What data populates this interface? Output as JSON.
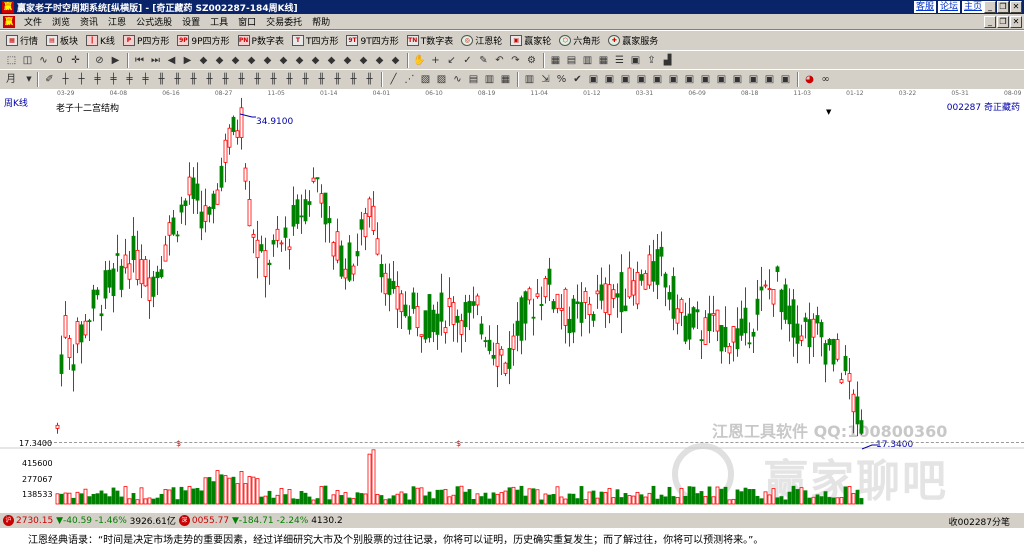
{
  "window": {
    "title": "赢家老子时空周期系统[纵横版] - [奇正藏药  SZ002287-184周K线]",
    "links": [
      "客服",
      "论坛",
      "主页"
    ]
  },
  "menu": [
    "文件",
    "浏览",
    "资讯",
    "江恩",
    "公式选股",
    "设置",
    "工具",
    "窗口",
    "交易委托",
    "帮助"
  ],
  "toolbar1": [
    {
      "label": "行情",
      "icon": "grid-icon"
    },
    {
      "label": "板块",
      "icon": "board-icon"
    },
    {
      "label": "K线",
      "icon": "kline-icon"
    },
    {
      "label": "P四方形",
      "icon": "p-square-icon"
    },
    {
      "label": "9P四方形",
      "icon": "9p-square-icon"
    },
    {
      "label": "P数字表",
      "icon": "p-table-icon"
    },
    {
      "label": "T四方形",
      "icon": "t-square-icon"
    },
    {
      "label": "9T四方形",
      "icon": "9t-square-icon"
    },
    {
      "label": "T数字表",
      "icon": "t-table-icon"
    },
    {
      "label": "江恩轮",
      "icon": "gann-wheel-icon"
    },
    {
      "label": "赢家轮",
      "icon": "winner-wheel-icon"
    },
    {
      "label": "六角形",
      "icon": "hexagon-icon"
    },
    {
      "label": "赢家服务",
      "icon": "service-icon"
    }
  ],
  "chart": {
    "period": "周K线",
    "period_select": "月",
    "indicator": "老子十二宫结构",
    "stock": "002287 奇正藏药",
    "high_label": "34.9100",
    "low_label": "17.3400",
    "low_axis_label": "17.3400",
    "watermark_text": "江恩工具软件 QQ:100800360",
    "watermark_big": "赢家聊吧",
    "dates": [
      "03-29",
      "04-08",
      "06-16",
      "08-27",
      "11-05",
      "01-14",
      "04-01",
      "06-10",
      "08-19",
      "11-04",
      "01-12",
      "03-31",
      "06-09",
      "08-18",
      "11-03",
      "01-12",
      "03-22",
      "05-31",
      "08-09"
    ],
    "vol_ticks": [
      "415600",
      "277067",
      "138533"
    ],
    "colors": {
      "up": "#ff0000",
      "down": "#008000",
      "accent": "#0000aa"
    }
  },
  "status": {
    "sh_index": "2730.15",
    "sh_change": "▼-40.59",
    "sh_pct": "-1.46%",
    "sh_amount": "3926.61亿",
    "sz_index": "0055.77",
    "sz_change": "▼-184.71",
    "sz_pct": "-2.24%",
    "sz_amount": "4130.2",
    "recv": "收002287分笔"
  },
  "quote": "江恩经典语录：“时间是决定市场走势的重要因素，经过详细研究大市及个别股票的过往记录，你将可以证明，历史确实重复发生；而了解过往，你将可以预测将来。”。"
}
